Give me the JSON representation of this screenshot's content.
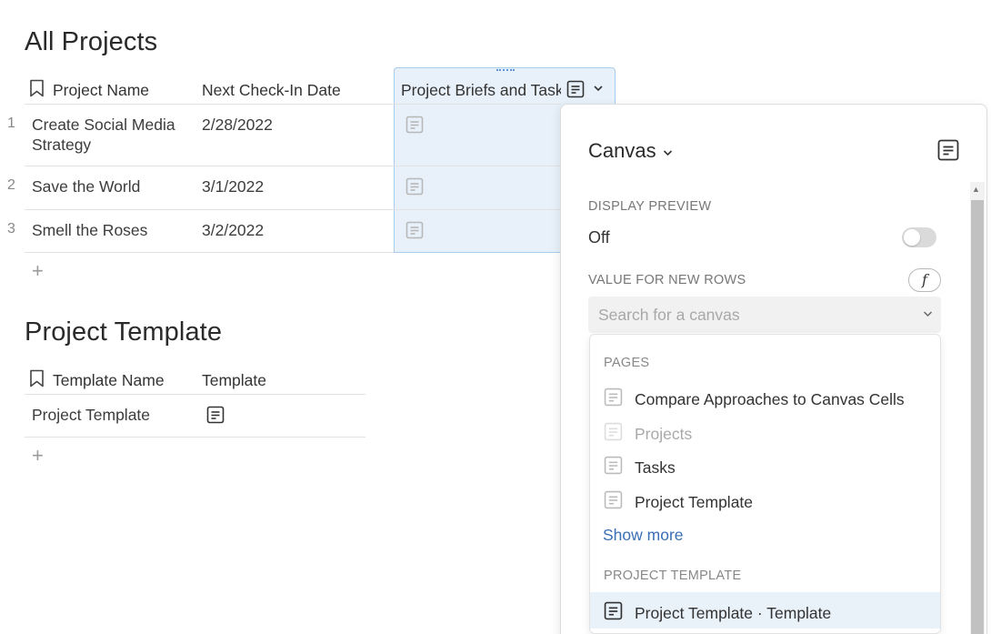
{
  "projects": {
    "title": "All Projects",
    "columns": [
      "Project Name",
      "Next Check-In Date",
      "Project Briefs and Task"
    ],
    "rows": [
      {
        "num": "1",
        "name_line1": "Create Social Media",
        "name_line2": "Strategy",
        "date": "2/28/2022"
      },
      {
        "num": "2",
        "name_line1": "Save the World",
        "name_line2": "",
        "date": "3/1/2022"
      },
      {
        "num": "3",
        "name_line1": "Smell the Roses",
        "name_line2": "",
        "date": "3/2/2022"
      }
    ],
    "add": "+"
  },
  "template": {
    "title": "Project Template",
    "columns": [
      "Template Name",
      "Template"
    ],
    "rows": [
      {
        "name": "Project Template"
      }
    ],
    "add": "+"
  },
  "panel": {
    "title": "Canvas",
    "display_preview_label": "DISPLAY PREVIEW",
    "display_preview_value": "Off",
    "value_new_rows_label": "VALUE FOR NEW ROWS",
    "fx": "f",
    "search_placeholder": "Search for a canvas",
    "dropdown": {
      "pages_label": "PAGES",
      "pages": [
        "Compare Approaches to Canvas Cells",
        "Projects",
        "Tasks",
        "Project Template"
      ],
      "show_more": "Show more",
      "template_label": "PROJECT TEMPLATE",
      "template_items": [
        "Project Template · Template"
      ]
    }
  },
  "colors": {
    "accent": "#3a6fb8",
    "selected_column_bg": "#e8f1fa",
    "selected_column_border": "#a9cdee"
  }
}
